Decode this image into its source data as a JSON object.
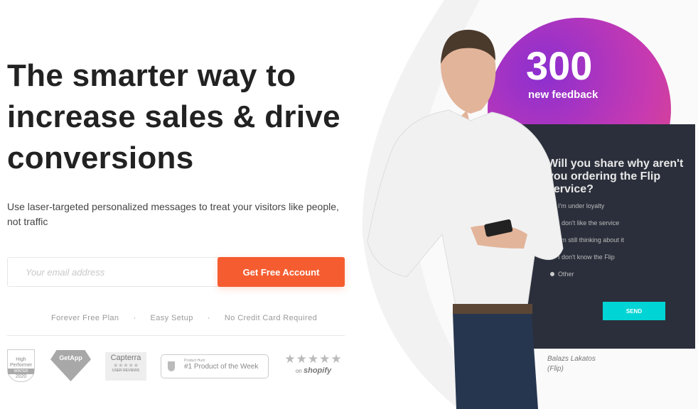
{
  "hero": {
    "title": "The smarter way to increase sales & drive conversions",
    "subtitle": "Use laser-targeted personalized messages to treat your visitors like people, not traffic"
  },
  "signup": {
    "email_placeholder": "Your email address",
    "cta_label": "Get Free Account"
  },
  "perks": [
    "Forever Free Plan",
    "·",
    "Easy Setup",
    "·",
    "No Credit Card Required"
  ],
  "badges": {
    "g2": {
      "line1": "High",
      "line2": "Performer",
      "season": "WINTER",
      "year": "2020"
    },
    "getapp": "GetApp",
    "capterra": {
      "name": "Capterra",
      "sub": "USER REVIEWS",
      "stars": "★★★★★"
    },
    "producthunt": {
      "small": "Product Hunt",
      "label": "#1 Product of the Week"
    },
    "shopify": {
      "stars": "★★★★★",
      "on": "on",
      "name": "shopify"
    }
  },
  "promo": {
    "count": "300",
    "count_label": "new feedback",
    "question": "Will you share why aren't you ordering the Flip service?",
    "options": [
      "I'm under loyalty",
      "I don't like the service",
      "I'm still thinking about it",
      "I don't know the Flip",
      "Other"
    ],
    "send_label": "SEND",
    "person_name": "Balazs Lakatos",
    "company": "(Flip)"
  },
  "colors": {
    "accent": "#f55d31",
    "send": "#00d4d4",
    "panel": "#2b2f3b"
  }
}
